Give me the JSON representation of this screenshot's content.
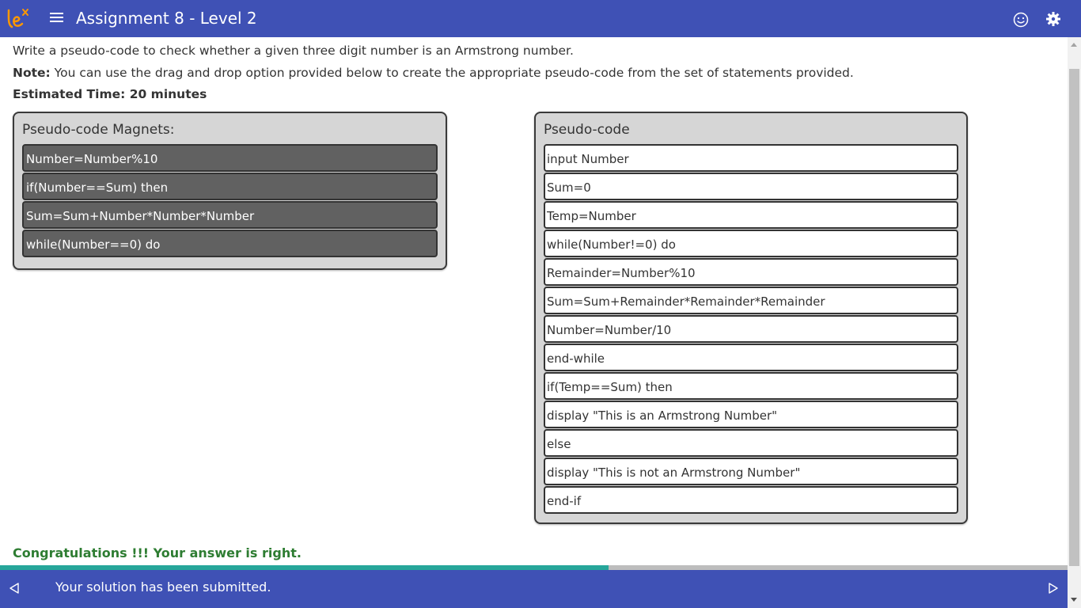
{
  "header": {
    "title": "Assignment 8 - Level 2",
    "logo_icon": "lex-logo-icon",
    "menu_icon": "hamburger-menu-icon",
    "right_icons": [
      "smiley-icon",
      "settings-gear-icon"
    ]
  },
  "instructions": {
    "question": "Write a pseudo-code to check whether a given three digit number is an Armstrong number.",
    "note_label": "Note:",
    "note_text": " You can use the drag and drop option provided below to create the appropriate pseudo-code from the set of statements provided.",
    "estimated_time": "Estimated Time: 20 minutes"
  },
  "magnets": {
    "title": "Pseudo-code Magnets:",
    "items": [
      "Number=Number%10",
      "if(Number==Sum) then",
      "Sum=Sum+Number*Number*Number",
      "while(Number==0) do"
    ]
  },
  "pseudocode": {
    "title": "Pseudo-code",
    "lines": [
      "input Number",
      "Sum=0",
      "Temp=Number",
      "while(Number!=0) do",
      "Remainder=Number%10",
      "Sum=Sum+Remainder*Remainder*Remainder",
      "Number=Number/10",
      "end-while",
      "if(Temp==Sum) then",
      "display \"This is an Armstrong Number\"",
      "else",
      "display \"This is not an Armstrong Number\"",
      "end-if"
    ]
  },
  "result": {
    "message": "Congratulations !!! Your answer is right."
  },
  "progress": {
    "fraction": 0.57
  },
  "footer": {
    "status": "Your solution has been submitted.",
    "prev_icon": "previous-arrow-icon",
    "next_icon": "next-arrow-icon"
  },
  "colors": {
    "primary": "#3f51b5",
    "success": "#2e7d32",
    "progress": "#26a69a",
    "magnet": "#616161",
    "logo_accent": "#ff9800"
  }
}
